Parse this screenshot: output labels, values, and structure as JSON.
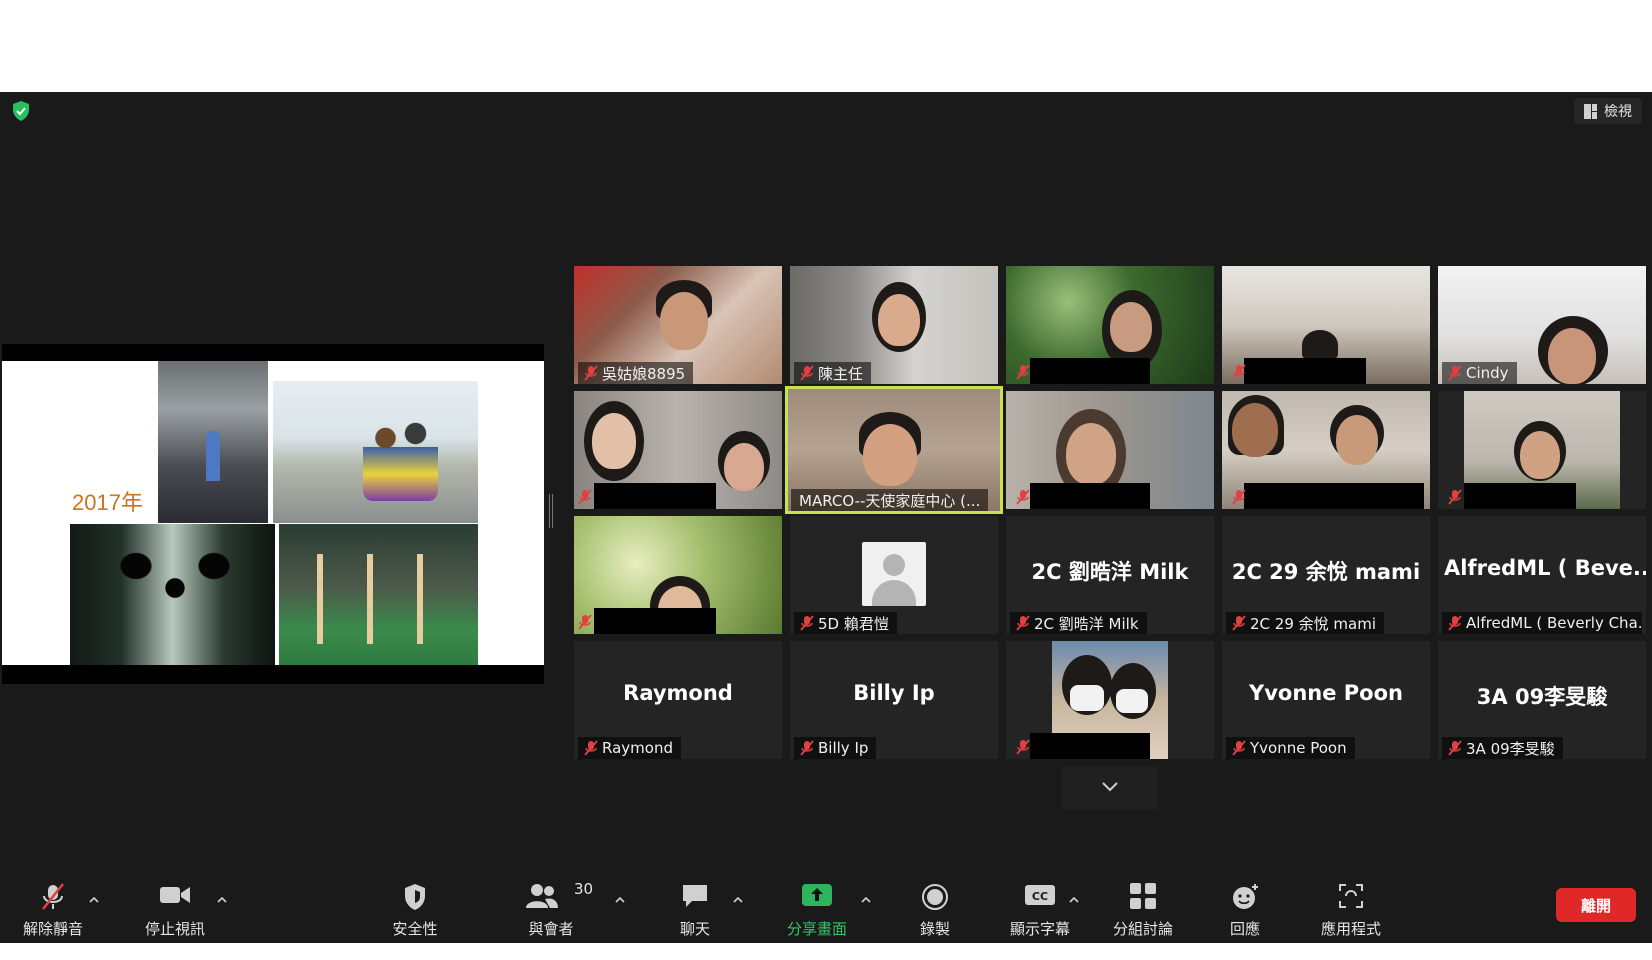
{
  "top": {
    "view_label": "檢視"
  },
  "slide": {
    "year_text": "2017年"
  },
  "participants": {
    "row1": [
      {
        "name": "吳姑娘8895"
      },
      {
        "name": "陳主任"
      },
      {
        "name": ""
      },
      {
        "name": ""
      },
      {
        "name": "Cindy"
      }
    ],
    "row2": [
      {
        "name": ""
      },
      {
        "name": "MARCO--天使家庭中心 (..."
      },
      {
        "name": ""
      },
      {
        "name": ""
      },
      {
        "name": ""
      }
    ],
    "row3": [
      {
        "name": ""
      },
      {
        "name": "5D 賴君愷"
      },
      {
        "display": "2C 劉晧洋 Milk",
        "name": "2C 劉晧洋 Milk"
      },
      {
        "display": "2C 29 余悅 mami",
        "name": "2C 29 余悅 mami"
      },
      {
        "display": "AlfredML ( Beve...",
        "name": "AlfredML ( Beverly Cha..."
      }
    ],
    "row4": [
      {
        "display": "Raymond",
        "name": "Raymond"
      },
      {
        "display": "Billy Ip",
        "name": "Billy Ip"
      },
      {
        "name": ""
      },
      {
        "display": "Yvonne Poon",
        "name": "Yvonne Poon"
      },
      {
        "display": "3A 09李旻駿",
        "name": "3A 09李旻駿"
      }
    ]
  },
  "toolbar": {
    "unmute": "解除靜音",
    "stop_video": "停止視訊",
    "security": "安全性",
    "participants": "與會者",
    "participants_count": "30",
    "chat": "聊天",
    "share_screen": "分享畫面",
    "record": "錄製",
    "captions": "顯示字幕",
    "breakout": "分組討論",
    "reactions": "回應",
    "apps": "應用程式",
    "leave": "離開"
  },
  "colors": {
    "accent_green": "#38c46a",
    "active_speaker": "#c6e24f",
    "leave_red": "#e02828",
    "mute_red": "#e04040"
  }
}
